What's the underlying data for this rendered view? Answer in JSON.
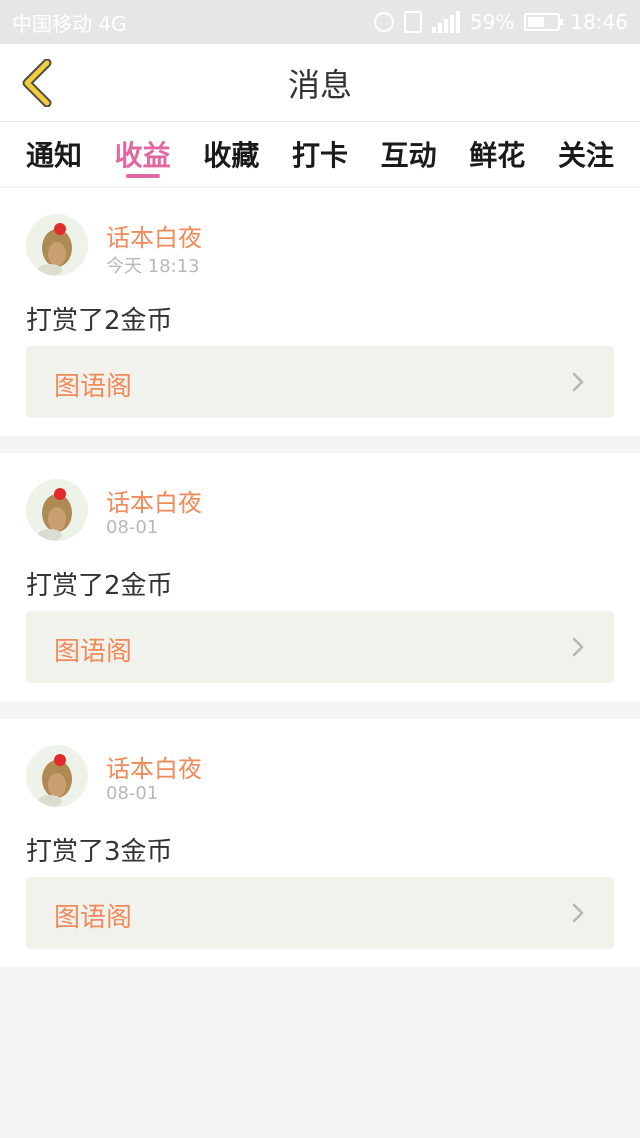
{
  "status_bar": {
    "carrier": "中国移动 4G",
    "battery": "59%",
    "time": "18:46"
  },
  "header": {
    "title": "消息"
  },
  "tabs": [
    {
      "label": "通知"
    },
    {
      "label": "收益",
      "active": true
    },
    {
      "label": "收藏"
    },
    {
      "label": "打卡"
    },
    {
      "label": "互动"
    },
    {
      "label": "鲜花"
    },
    {
      "label": "关注"
    }
  ],
  "messages": [
    {
      "user": "话本白夜",
      "time": "今天 18:13",
      "text": "打赏了2金币",
      "link": "图语阁"
    },
    {
      "user": "话本白夜",
      "time": "08-01",
      "text": "打赏了2金币",
      "link": "图语阁"
    },
    {
      "user": "话本白夜",
      "time": "08-01",
      "text": "打赏了3金币",
      "link": "图语阁"
    }
  ],
  "colors": {
    "accent": "#e0679f",
    "name": "#f08a5a",
    "back_icon": "#f2cc3a"
  },
  "icons": {
    "back": "chevron-left-icon",
    "link": "chevron-right-icon"
  }
}
